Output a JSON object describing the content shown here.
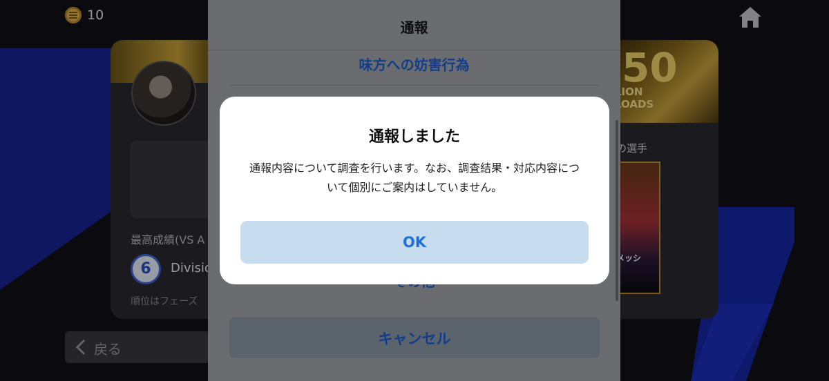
{
  "header": {
    "coin_count": "10"
  },
  "left_card": {
    "record_label": "最高成績(VS A",
    "division_number": "6",
    "division_label": "Divisio",
    "note": "順位はフェーズ"
  },
  "right_card": {
    "banner_number": "50",
    "banner_text": "LION\nLOADS",
    "label": "の選手",
    "player_name": "メッシ"
  },
  "back_button": {
    "label": "戻る"
  },
  "sheet": {
    "title": "通報",
    "item_1": "味方への妨害行為",
    "item_2": "その他",
    "cancel_label": "キャンセル"
  },
  "dialog": {
    "title": "通報しました",
    "body": "通報内容について調査を行います。なお、調査結果・対応内容について個別にご案内はしていません。",
    "ok_label": "OK"
  },
  "colors": {
    "accent_blue": "#1f5fd0",
    "ok_button_bg": "#c8dcf0",
    "stripe_blue": "#1a2bbf"
  }
}
